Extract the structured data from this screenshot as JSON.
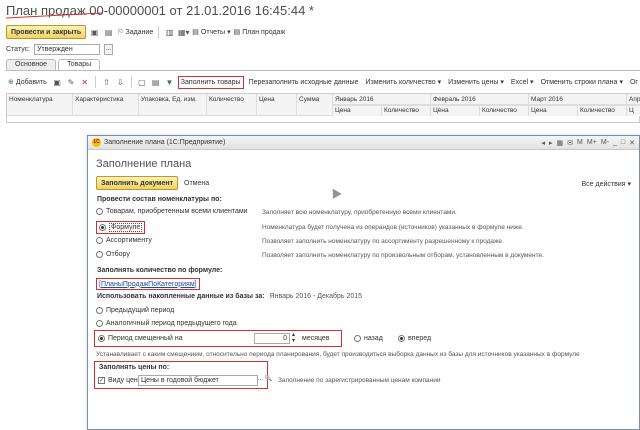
{
  "document": {
    "title": "План продаж 00-00000001 от 21.01.2016 16:45:44 *"
  },
  "command_bar": {
    "post_close": "Провести и закрыть",
    "task": "Задание",
    "reports": "Отчеты",
    "sales_plan": "План продаж"
  },
  "status": {
    "label": "Статус:",
    "value": "Утвержден"
  },
  "tabs": [
    {
      "label": "Основное"
    },
    {
      "label": "Товары"
    }
  ],
  "table_toolbar": {
    "add": "Добавить",
    "fill_goods": "Заполнить товары",
    "refill": "Перезаполнить исходные данные",
    "change_qty": "Изменить количество",
    "change_prices": "Изменить цены",
    "excel": "Excel",
    "cancel_rows": "Отменить строки плана",
    "more": "Ог"
  },
  "grid": {
    "columns": [
      "Номенклатура",
      "Характеристика",
      "Упаковка, Ед. изм.",
      "Количество",
      "Цена",
      "Сумма",
      "Январь 2016",
      "Февраль 2016",
      "Март 2016",
      "Апр"
    ],
    "sub_columns": [
      "Цена",
      "Количество",
      "Цена",
      "Количество",
      "Цена",
      "Количество",
      "Ц"
    ]
  },
  "dialog": {
    "window_title": "Заполнение плана  (1С:Предприятие)",
    "heading": "Заполнение плана",
    "fill_button": "Заполнить документ",
    "cancel_button": "Отмена",
    "all_actions": "Все действия",
    "section_nomenclature": "Провести состав номенклатуры по:",
    "options": [
      {
        "label": "Товарам, приобретенным всеми клиентами",
        "desc": "Заполняет всю номенклатуру, приобретенную всеми клиентами."
      },
      {
        "label": "Формуле",
        "desc": "Номенклатура будет получена из операндов (источников) указанных в формуле ниже."
      },
      {
        "label": "Ассортименту",
        "desc": "Позволяет заполнить номенклатуру по ассортименту разрешенному к продаже."
      },
      {
        "label": "Отбору",
        "desc": "Позволяет заполнить номенклатуру по произвольным отборам, установленным в документе."
      }
    ],
    "section_qty": "Заполнять количество по формуле:",
    "formula": "[ПланыПродажПоКатегориям]",
    "section_accum": "Использовать накопленные данные из базы за:",
    "accum_period": "Январь 2016 - Декабрь 2015",
    "period_prev": "Предыдущий период",
    "period_analog": "Аналогичный период предыдущего года",
    "period_shift": "Период смещенный на",
    "shift_value": "0",
    "shift_unit": "месяцев",
    "back": "назад",
    "forward": "вперед",
    "shift_note": "Устанавливает с каким смещением, относительно периода планирования, будет производиться выборка данных из базы для источников указанных в формуле",
    "section_prices": "Заполнять цены по:",
    "price_type_label": "Виду цен",
    "price_type_value": "Цены в годовой бюджет",
    "prices_desc": "Заполнение по зарегистрированным ценам компании"
  }
}
